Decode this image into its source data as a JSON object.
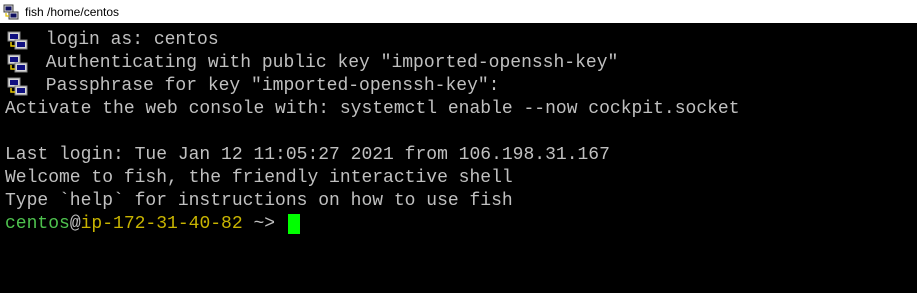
{
  "window": {
    "title": "fish /home/centos",
    "app_icon": "putty-icon"
  },
  "terminal": {
    "background": "#000000",
    "text_color": "#c0c0c0",
    "lines": [
      {
        "text": " login as: centos",
        "icon": "putty-icon"
      },
      {
        "text": " Authenticating with public key \"imported-openssh-key\"",
        "icon": "putty-icon"
      },
      {
        "text": " Passphrase for key \"imported-openssh-key\":",
        "icon": "putty-icon"
      },
      {
        "text": "Activate the web console with: systemctl enable --now cockpit.socket"
      },
      {
        "text": ""
      },
      {
        "text": "Last login: Tue Jan 12 11:05:27 2021 from 106.198.31.167"
      },
      {
        "text": "Welcome to fish, the friendly interactive shell"
      },
      {
        "text": "Type `help` for instructions on how to use fish"
      }
    ],
    "prompt": {
      "user": "centos",
      "at": "@",
      "host": "ip-172-31-40-82",
      "cwd": " ~>",
      "user_color": "#4ec24e",
      "host_color": "#c8b400",
      "cursor_color": "#00ff00"
    }
  }
}
